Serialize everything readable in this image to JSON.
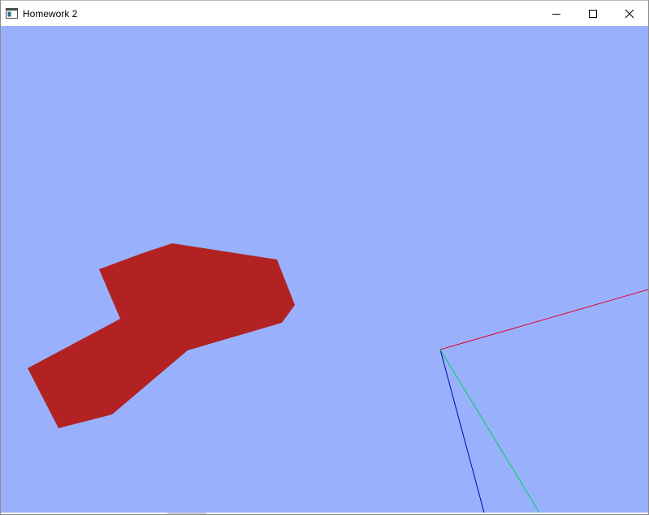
{
  "window": {
    "title": "Homework 2"
  },
  "controls": {
    "minimize_icon": "minimize-icon",
    "maximize_icon": "maximize-icon",
    "close_icon": "close-icon"
  },
  "scene": {
    "background_color": "#99b1fd",
    "shape_color": "#b22222",
    "axis_colors": {
      "x": "#e8002a",
      "y": "#0000aa",
      "z": "#00cc55"
    }
  }
}
